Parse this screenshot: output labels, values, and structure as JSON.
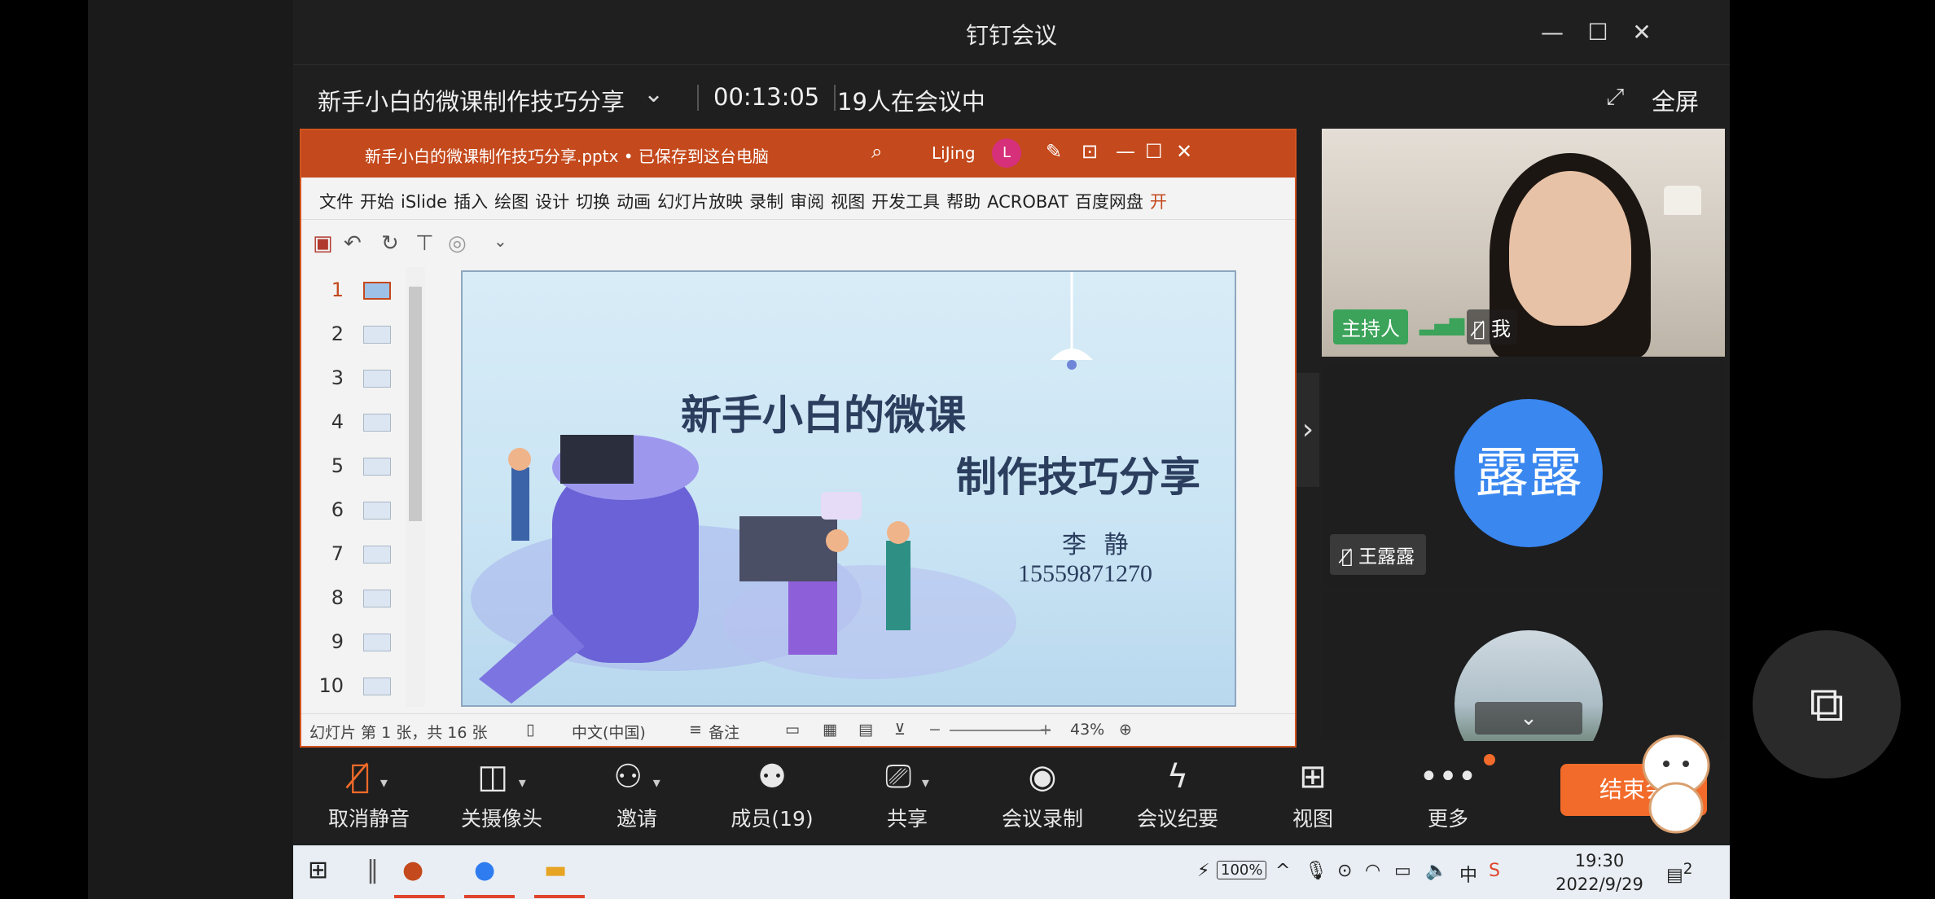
{
  "window": {
    "title": "钉钉会议"
  },
  "window_controls": {
    "minimize": "—",
    "maximize": "☐",
    "close": "✕"
  },
  "meeting": {
    "title": "新手小白的微课制作技巧分享",
    "elapsed": "00:13:05",
    "participants_text": "19人在会议中",
    "fullscreen_label": "全屏"
  },
  "ppt": {
    "filename": "新手小白的微课制作技巧分享.pptx • 已保存到这台电脑",
    "user": "LiJing",
    "avatar_letter": "L",
    "ribbon_tabs": [
      "文件",
      "开始",
      "iSlide",
      "插入",
      "绘图",
      "设计",
      "切换",
      "动画",
      "幻灯片放映",
      "录制",
      "审阅",
      "视图",
      "开发工具",
      "帮助",
      "ACROBAT",
      "百度网盘",
      "开"
    ],
    "thumb_numbers": [
      "1",
      "2",
      "3",
      "4",
      "5",
      "6",
      "7",
      "8",
      "9",
      "10"
    ],
    "slide": {
      "title_line1": "新手小白的微课",
      "title_line2": "制作技巧分享",
      "author": "李 静",
      "phone": "15559871270"
    },
    "status": {
      "slide_info": "幻灯片 第 1 张，共 16 张",
      "language": "中文(中国)",
      "notes": "备注",
      "zoom": "43%"
    }
  },
  "participants": {
    "host_tag": "主持人",
    "me_tag": "我",
    "second_avatar": "露露",
    "second_name": "王露露"
  },
  "toolbar": {
    "unmute": "取消静音",
    "camera_off": "关摄像头",
    "invite": "邀请",
    "members": "成员(19)",
    "share": "共享",
    "record": "会议录制",
    "minutes": "会议纪要",
    "view": "视图",
    "more": "更多",
    "end": "结束会"
  },
  "taskbar": {
    "battery": "100%",
    "ime": "中",
    "time": "19:30",
    "date": "2022/9/29",
    "notif_count": "2"
  }
}
